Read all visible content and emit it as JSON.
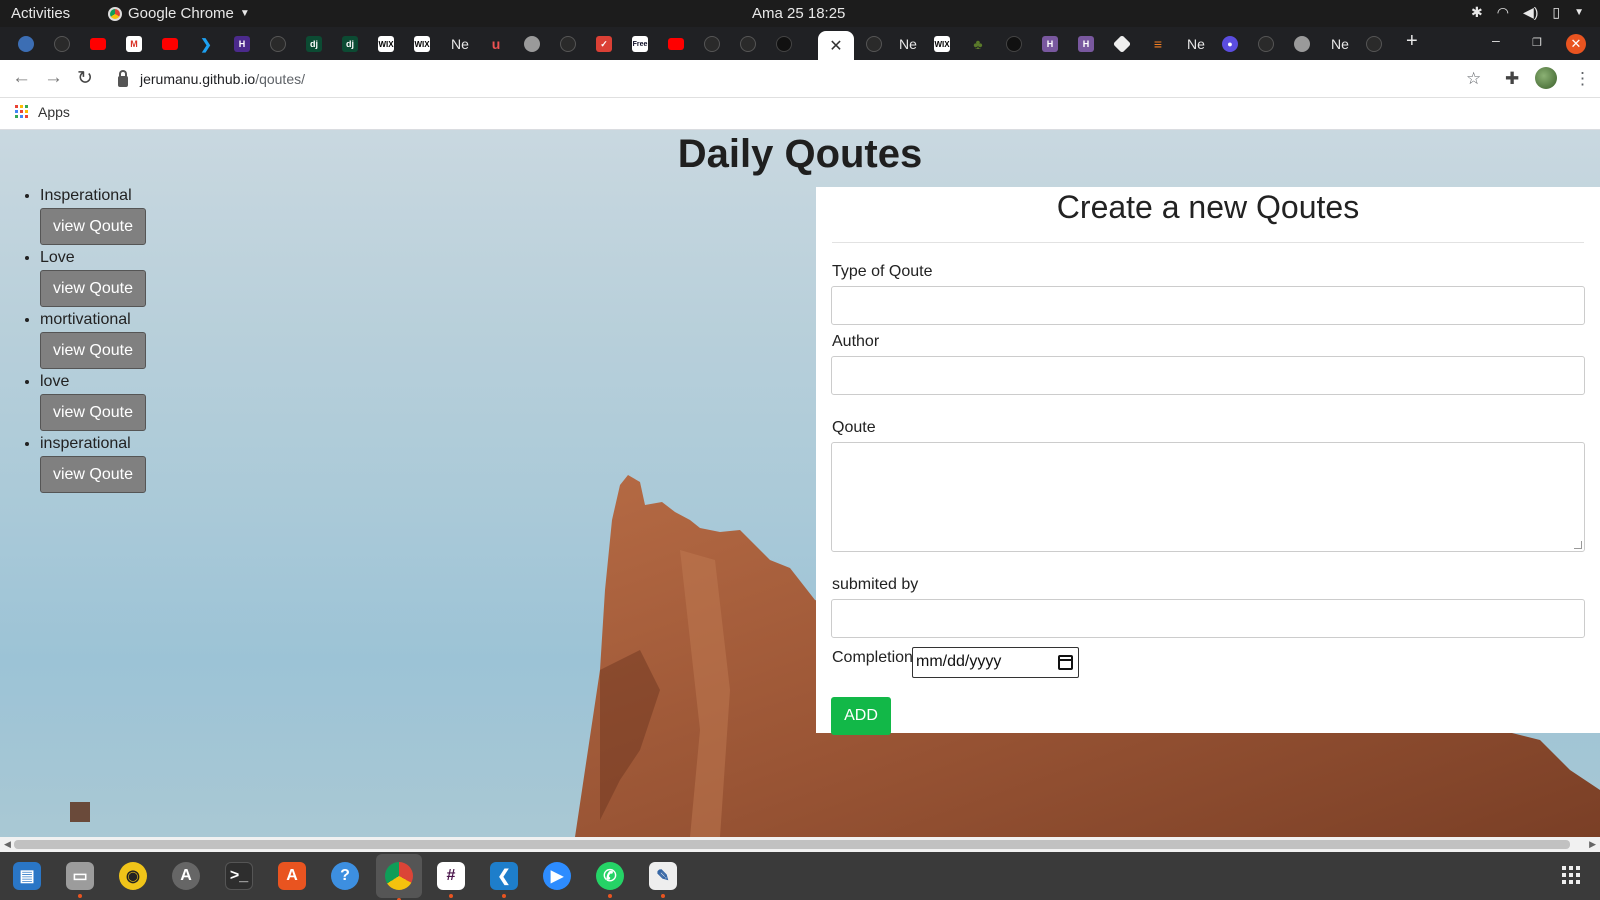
{
  "system_bar": {
    "activities": "Activities",
    "app_name": "Google Chrome",
    "clock": "Ama 25  18:25"
  },
  "tabs": {
    "ne_label": "Ne",
    "new_tab_icon": "plus-icon",
    "close_icon": "close-icon"
  },
  "toolbar": {
    "url_host": "jerumanu.github.io",
    "url_path": "/qoutes/"
  },
  "bookmarks": {
    "apps_label": "Apps"
  },
  "page": {
    "title": "Daily Qoutes",
    "categories": [
      {
        "name": "Insperational",
        "button": "view Qoute"
      },
      {
        "name": "Love",
        "button": "view Qoute"
      },
      {
        "name": "mortivational",
        "button": "view Qoute"
      },
      {
        "name": "love",
        "button": "view Qoute"
      },
      {
        "name": "insperational",
        "button": "view Qoute"
      }
    ],
    "form": {
      "title": "Create a new Qoutes",
      "type_label": "Type of Qoute",
      "type_value": "",
      "author_label": "Author",
      "author_value": "",
      "qoute_label": "Qoute",
      "qoute_value": "",
      "submitted_label": "submited by",
      "submitted_value": "",
      "completion_label": "Completion",
      "completion_placeholder": "mm/dd/yyyy",
      "add_button": "ADD"
    }
  },
  "colors": {
    "add_button": "#12b848",
    "view_button": "#808080",
    "dock_bg": "#3a3a3a",
    "close_button": "#e95420"
  }
}
